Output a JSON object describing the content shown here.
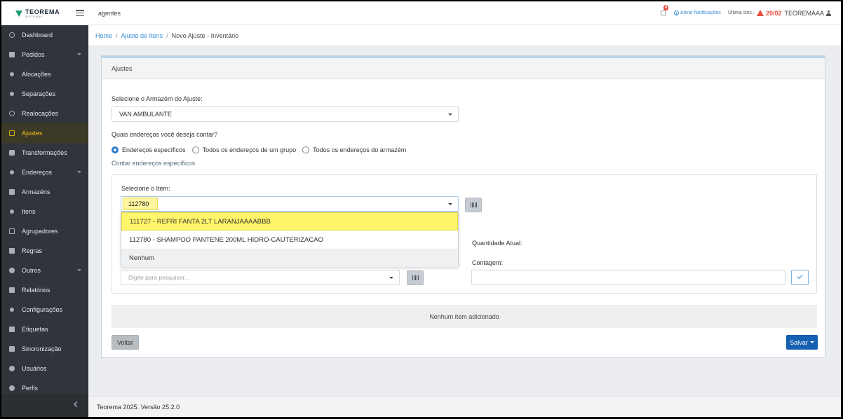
{
  "header": {
    "logo_text": "TEOREMA",
    "logo_sub": "SISTEMAS",
    "context": "agentes",
    "notification_count": "4",
    "notifications_link": "Ativar Notificações",
    "sync_label": "Última sinc.:",
    "sync_date": "20/02",
    "username": "TEOREMAAA"
  },
  "sidebar": {
    "items": [
      {
        "label": "Dashboard",
        "icon": "dashboard-icon"
      },
      {
        "label": "Pedidos",
        "icon": "orders-icon"
      },
      {
        "label": "Alocações",
        "icon": "allocation-icon"
      },
      {
        "label": "Separações",
        "icon": "separation-icon"
      },
      {
        "label": "Realocações",
        "icon": "reallocation-icon"
      },
      {
        "label": "Ajustes",
        "icon": "adjustments-icon"
      },
      {
        "label": "Transformações",
        "icon": "transform-icon"
      },
      {
        "label": "Endereços",
        "icon": "location-pin-icon"
      },
      {
        "label": "Armazéns",
        "icon": "warehouse-icon"
      },
      {
        "label": "Itens",
        "icon": "items-icon"
      },
      {
        "label": "Agrupadores",
        "icon": "group-icon"
      },
      {
        "label": "Regras",
        "icon": "rules-icon"
      },
      {
        "label": "Outros",
        "icon": "others-icon"
      },
      {
        "label": "Relatórios",
        "icon": "report-icon"
      },
      {
        "label": "Configurações",
        "icon": "gear-icon"
      },
      {
        "label": "Etiquetas",
        "icon": "tag-icon"
      },
      {
        "label": "Sincronização",
        "icon": "sync-icon"
      },
      {
        "label": "Usuários",
        "icon": "user-icon"
      },
      {
        "label": "Perfis",
        "icon": "users-icon"
      }
    ],
    "active_color": "#f0c419"
  },
  "breadcrumb": {
    "home": "Home",
    "parent": "Ajuste de Itens",
    "current": "Novo Ajuste - Inventário"
  },
  "card": {
    "title": "Ajustes",
    "warehouse_label": "Selecione o Armazém do Ajuste:",
    "warehouse_value": "VAN AMBULANTE",
    "addresses_question": "Quais endereços você deseja contar?",
    "radio_options": [
      "Endereços específicos",
      "Todos os endereços de um grupo",
      "Todos os endereços do armazém"
    ],
    "selected_radio": "Endereços específicos",
    "sub_link": "Contar endereços específicos",
    "item_label": "Selecione o Item:",
    "item_search_value": "112780",
    "dropdown_options": [
      "111727 - REFRI FANTA 2LT LARANJAAAABBB",
      "112780 - SHAMPOO PANTENE 200ML HIDRO-CAUTERIZACAO",
      "Nenhum"
    ],
    "second_select_placeholder": "Digite para pesquisar...",
    "current_qty_label": "Quantidade Atual:",
    "count_label": "Contagem:",
    "empty_message": "Nenhum item adicionado",
    "back_button": "Voltar",
    "save_button": "Salvar"
  },
  "footer": {
    "text": "Teorema 2025. Versão 25.2.0"
  },
  "colors": {
    "primary": "#1560b0",
    "link": "#3a8fd6",
    "highlight": "#fff56a",
    "alert": "#e74c3c"
  }
}
